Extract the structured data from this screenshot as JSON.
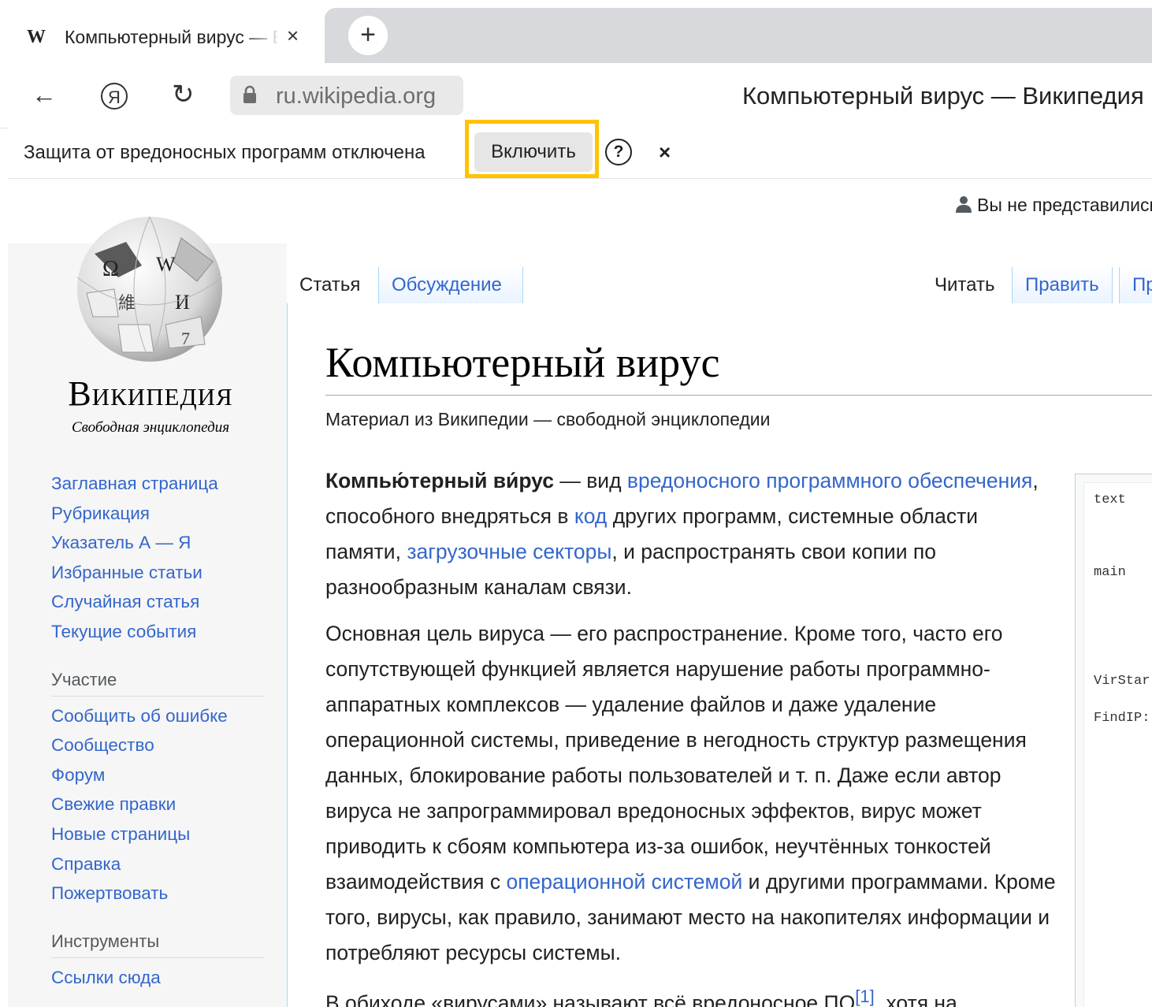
{
  "browser": {
    "tab": {
      "favicon": "W",
      "title": "Компьютерный вирус — Википедия",
      "close_icon": "×"
    },
    "new_tab_icon": "+",
    "toolbar": {
      "back_icon": "←",
      "yandex_icon": "Я",
      "reload_icon": "↻",
      "address": "ru.wikipedia.org",
      "page_title": "Компьютерный вирус — Википедия"
    },
    "infobar": {
      "message": "Защита от вредоносных программ отключена",
      "enable_button": "Включить",
      "help_icon": "?",
      "close_icon": "×",
      "highlight_color": "#ffc300"
    }
  },
  "wiki": {
    "logo": {
      "wordmark": "Википедия",
      "tagline": "Свободная энциклопедия"
    },
    "nav_main": [
      "Заглавная страница",
      "Рубрикация",
      "Указатель А — Я",
      "Избранные статьи",
      "Случайная статья",
      "Текущие события"
    ],
    "nav_participation": {
      "heading": "Участие",
      "items": [
        "Сообщить об ошибке",
        "Сообщество",
        "Форум",
        "Свежие правки",
        "Новые страницы",
        "Справка",
        "Пожертвовать"
      ]
    },
    "nav_tools": {
      "heading": "Инструменты",
      "items": [
        "Ссылки сюда"
      ]
    },
    "user_status": "Вы не представились",
    "tabs": {
      "article": "Статья",
      "talk": "Обсуждение",
      "read": "Читать",
      "edit": "Править",
      "history": "Пр"
    },
    "article": {
      "title": "Компьютерный вирус",
      "subtitle": "Материал из Википедии — свободной энциклопедии",
      "p1": {
        "lead": "Компью́терный ви́рус",
        "t1": " — вид ",
        "l1": "вредоносного программного обеспечения",
        "t2": ", способного внедряться в ",
        "l2": "код",
        "t3": " других программ, системные области памяти, ",
        "l3": "загрузочные секторы",
        "t4": ", и распространять свои копии по разнообразным каналам связи."
      },
      "p2": {
        "t1": "Основная цель вируса — его распространение. Кроме того, часто его сопутствующей функцией является нарушение работы программно-аппаратных комплексов — удаление файлов и даже удаление операционной системы, приведение в негодность структур размещения данных, блокирование работы пользователей и т. п. Даже если автор вируса не запрограммировал вредоносных эффектов, вирус может приводить к сбоям компьютера из-за ошибок, неучтённых тонкостей взаимодействия с ",
        "l1": "операционной системой",
        "t2": " и другими программами. Кроме того, вирусы, как правило, занимают место на накопителях информации и потребляют ресурсы системы."
      },
      "p3": {
        "t1": "В обиходе «вирусами» называют всё вредоносное ПО",
        "ref": "[1]",
        "t2": ", хотя на"
      }
    },
    "code_sample": [
      "text",
      "main",
      "VirStar",
      "FindIP:"
    ]
  }
}
